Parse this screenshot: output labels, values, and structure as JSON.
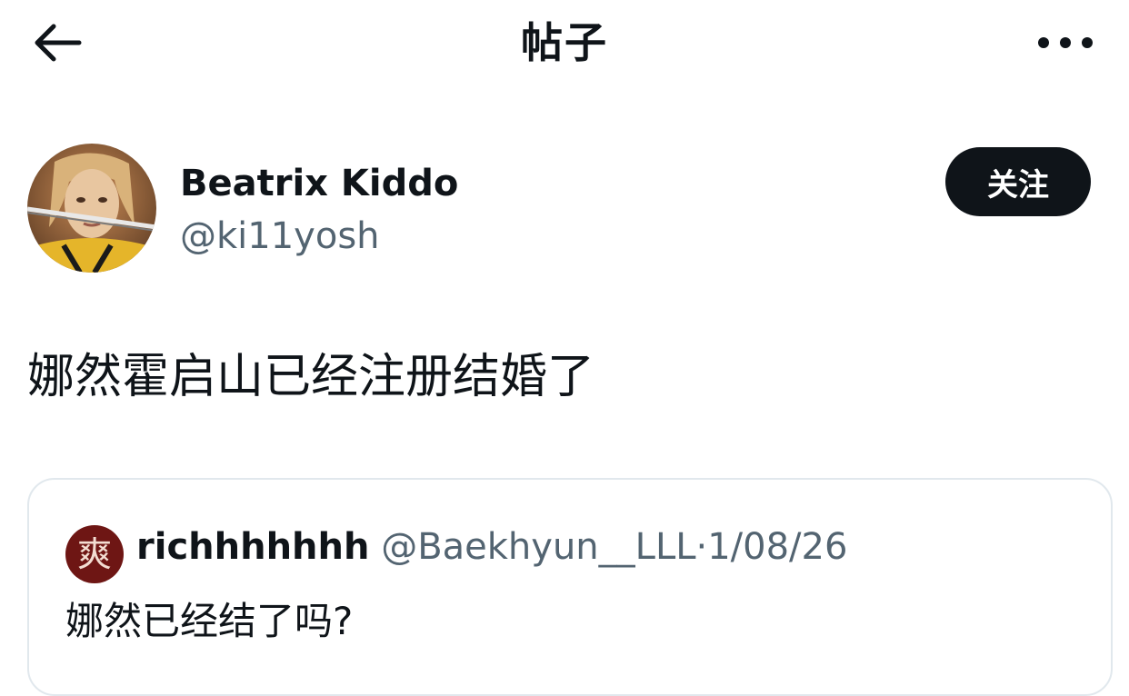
{
  "header": {
    "title": "帖子",
    "back_icon": "arrow-left-icon",
    "more_icon": "more-horizontal-icon"
  },
  "post": {
    "author": {
      "display_name": "Beatrix Kiddo",
      "handle": "@ki11yosh"
    },
    "follow_label": "关注",
    "text": "娜然霍启山已经注册结婚了"
  },
  "quote": {
    "avatar_glyph": "爽",
    "display_name": "richhhhhhh",
    "handle": "@Baekhyun__LLL",
    "separator": "·",
    "date": "1/08/26",
    "text": "娜然已经结了吗?"
  },
  "colors": {
    "text_primary": "#0f1419",
    "text_secondary": "#536471",
    "border": "#e1e8ed",
    "follow_button_bg": "#0f1419",
    "quote_avatar_bg": "#6e1614"
  }
}
